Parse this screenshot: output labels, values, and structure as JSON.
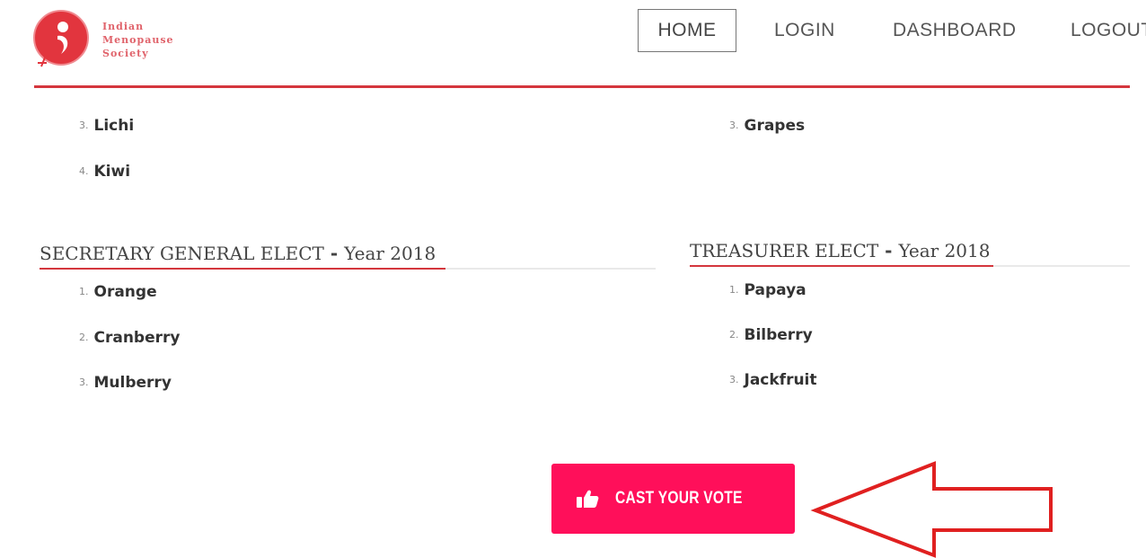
{
  "logo": {
    "line1": "Indian",
    "line2": "Menopause",
    "line3": "Society",
    "brand_color": "#d4363d"
  },
  "nav": {
    "home": "HOME",
    "login": "LOGIN",
    "dashboard": "DASHBOARD",
    "logout": "LOGOUT"
  },
  "top_lists": {
    "left": [
      {
        "num": "3.",
        "label": "Lichi"
      },
      {
        "num": "4.",
        "label": "Kiwi"
      }
    ],
    "right": [
      {
        "num": "3.",
        "label": "Grapes"
      }
    ]
  },
  "sections": {
    "secretary": {
      "title": "SECRETARY GENERAL ELECT",
      "sep": " - ",
      "year": "Year 2018",
      "items": [
        {
          "num": "1.",
          "label": "Orange"
        },
        {
          "num": "2.",
          "label": "Cranberry"
        },
        {
          "num": "3.",
          "label": "Mulberry"
        }
      ]
    },
    "treasurer": {
      "title": "TREASURER ELECT",
      "sep": " - ",
      "year": "Year 2018",
      "items": [
        {
          "num": "1.",
          "label": "Papaya"
        },
        {
          "num": "2.",
          "label": "Bilberry"
        },
        {
          "num": "3.",
          "label": "Jackfruit"
        }
      ]
    }
  },
  "vote_button": {
    "label": "CAST YOUR VOTE",
    "icon": "thumbs-up-icon",
    "color": "#ff0f5a"
  },
  "annotation": {
    "icon": "left-arrow-outline-icon",
    "color": "#e02020"
  }
}
